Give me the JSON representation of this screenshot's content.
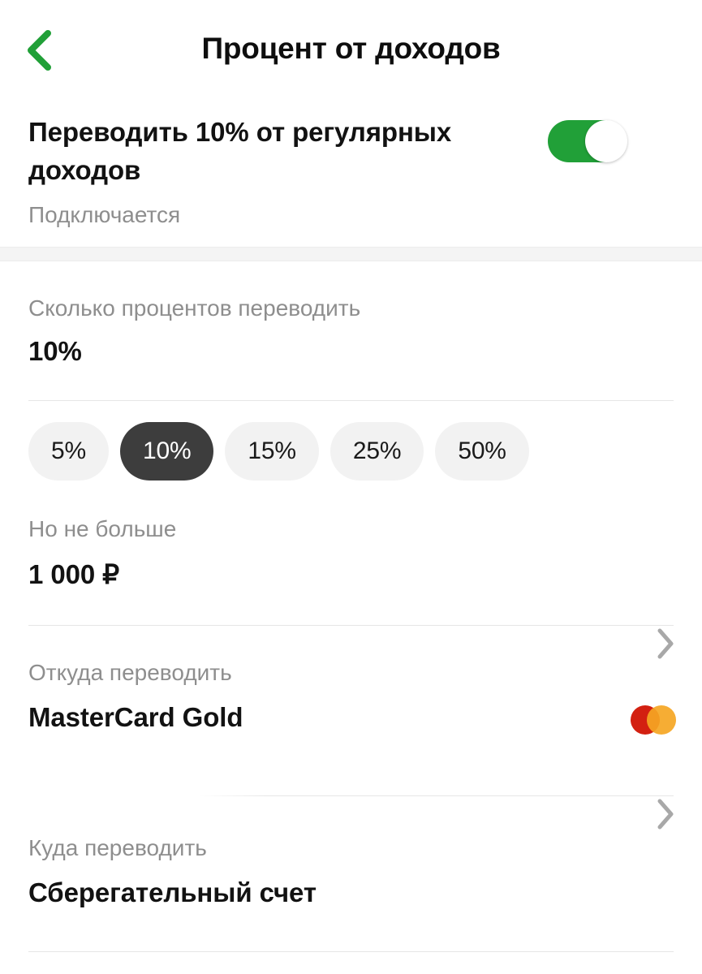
{
  "header": {
    "title": "Процент от доходов",
    "back_icon": "chevron-left-icon",
    "accent_color": "#21a038"
  },
  "toggle_block": {
    "title": "Переводить 10% от регулярных доходов",
    "status": "Подключается",
    "enabled": true,
    "toggle_color": "#21a038"
  },
  "percent_field": {
    "label": "Сколько процентов переводить",
    "value": "10%"
  },
  "chips": {
    "options": [
      {
        "label": "5%",
        "selected": false
      },
      {
        "label": "10%",
        "selected": true
      },
      {
        "label": "15%",
        "selected": false
      },
      {
        "label": "25%",
        "selected": false
      },
      {
        "label": "50%",
        "selected": false
      }
    ],
    "selected_background": "#3d3d3d",
    "default_background": "#f2f2f2"
  },
  "limit_field": {
    "label": "Но не больше",
    "value": "1 000 ₽"
  },
  "source_field": {
    "label": "Откуда переводить",
    "value": "MasterCard Gold",
    "chevron_icon": "chevron-right-icon",
    "card_brand_icon": "mastercard-logo-icon",
    "brand_colors": {
      "left": "#d32011",
      "right": "#f5a623"
    }
  },
  "destination_field": {
    "label": "Куда переводить",
    "value": "Сберегательный счет",
    "chevron_icon": "chevron-right-icon"
  }
}
